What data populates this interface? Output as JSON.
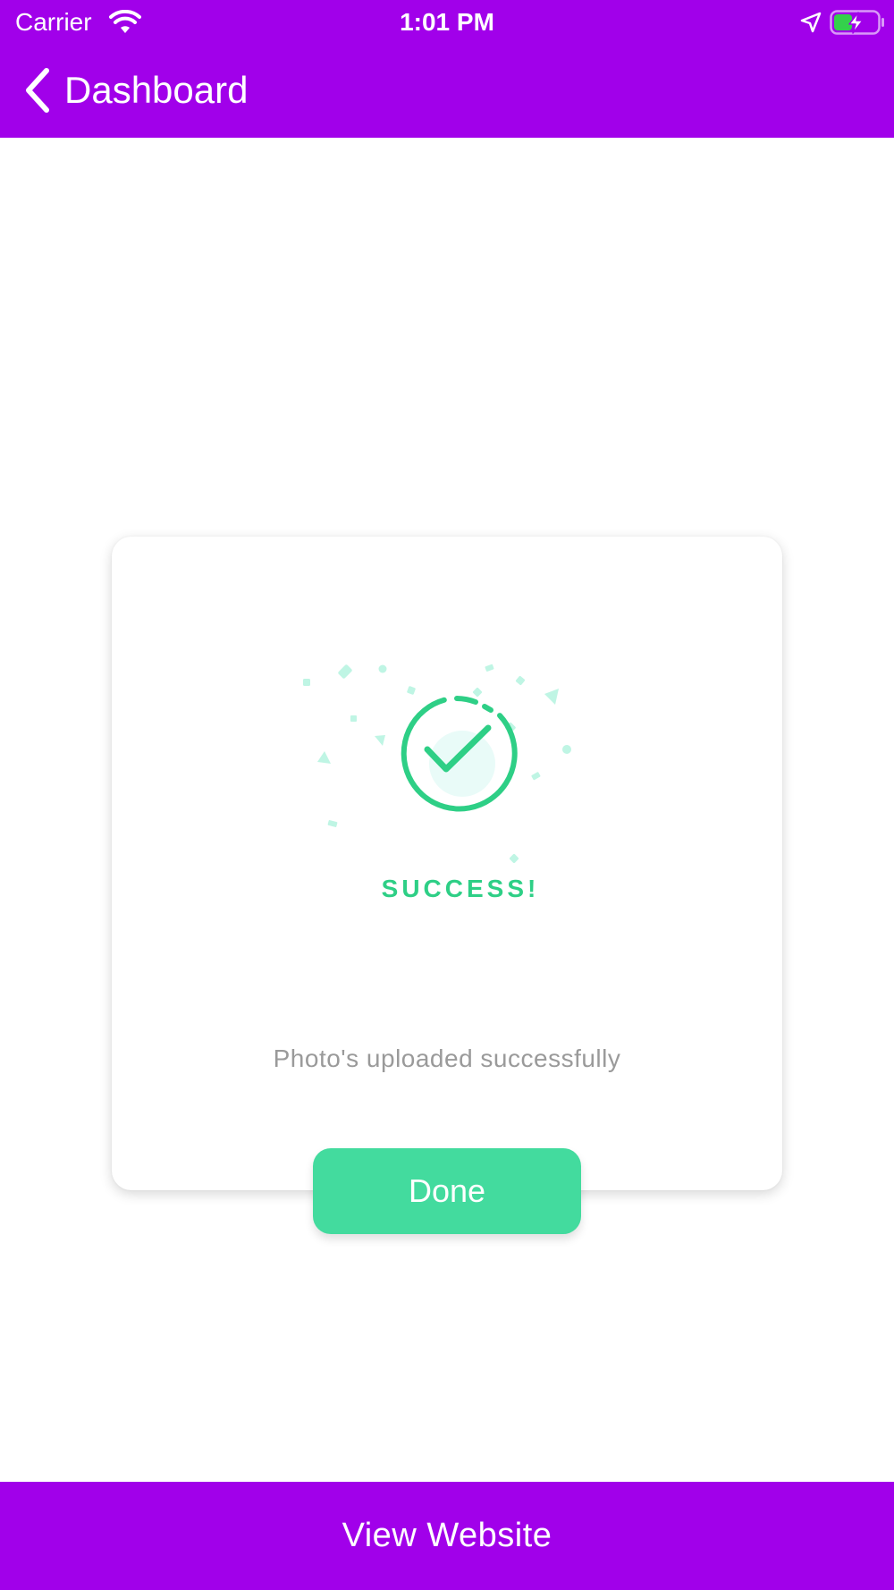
{
  "status_bar": {
    "carrier": "Carrier",
    "time": "1:01 PM",
    "icons": [
      "wifi-icon",
      "location-arrow-icon",
      "battery-charging-icon"
    ]
  },
  "nav_bar": {
    "back_label": "Dashboard",
    "icon": "chevron-left-icon"
  },
  "card": {
    "illustration_icon": "success-check-icon",
    "success_text": "SUCCESS!",
    "message": "Photo's uploaded successfully",
    "done_label": "Done"
  },
  "bottom_bar": {
    "label": "View Website"
  },
  "colors": {
    "brand_purple": "#a100ea",
    "success_green": "#2ecf86",
    "button_green": "#43db9e",
    "message_gray": "#9a9a9a"
  }
}
